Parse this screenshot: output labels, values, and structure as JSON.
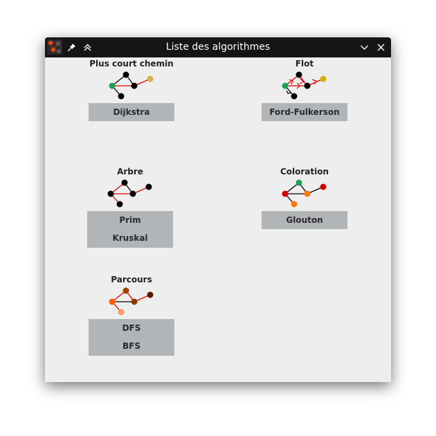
{
  "window": {
    "title": "Liste des algorithmes"
  },
  "groups": {
    "shortest_path": {
      "title": "Plus court chemin",
      "buttons": [
        "Dijkstra"
      ]
    },
    "flow": {
      "title": "Flot",
      "buttons": [
        "Ford-Fulkerson"
      ]
    },
    "tree": {
      "title": "Arbre",
      "buttons": [
        "Prim",
        "Kruskal"
      ]
    },
    "coloring": {
      "title": "Coloration",
      "buttons": [
        "Glouton"
      ]
    },
    "traversal": {
      "title": "Parcours",
      "buttons": [
        "DFS",
        "BFS"
      ]
    }
  },
  "colors": {
    "titlebar": "#151515",
    "window_bg": "#eeeeee",
    "button_bg": "#b1b5b8",
    "edge_highlight": "#e00000",
    "node_default": "#000000",
    "node_green": "#1aa351",
    "node_yellow": "#d6b04a",
    "node_red": "#d60000",
    "node_orange": "#ff7700",
    "node_brown": "#8b3a00",
    "node_dark_brown": "#5a1a00",
    "node_light_orange": "#ff9966"
  },
  "icons": {
    "app": "graph-app-icon",
    "pin": "pin-icon",
    "keep_above": "chevrons-up-icon",
    "minimize": "chevron-down-icon",
    "close": "close-icon"
  }
}
